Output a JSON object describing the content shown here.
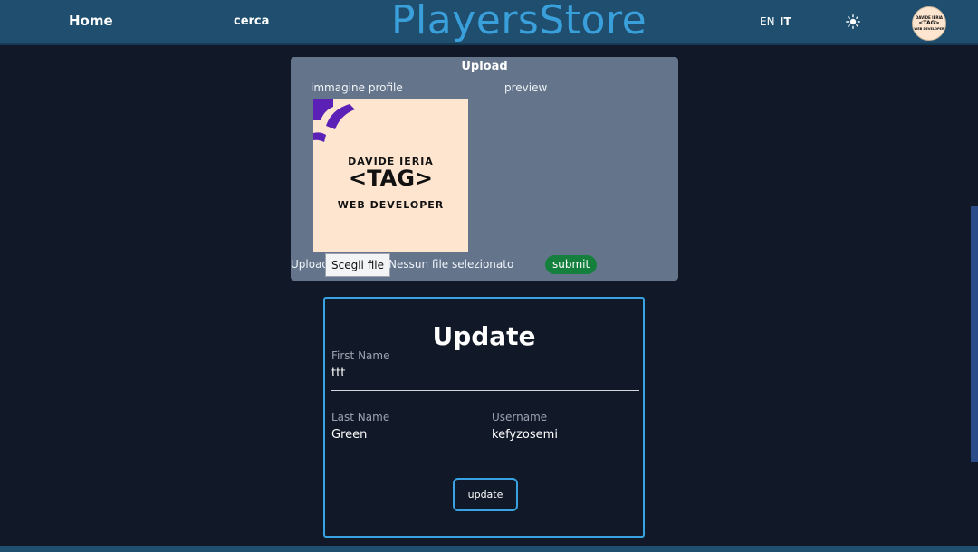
{
  "navbar": {
    "home": "Home",
    "search": "cerca",
    "brand": "PlayersStore",
    "lang_en": "EN",
    "lang_it": "IT",
    "theme_icon": "sun-icon",
    "avatar_name": "DAVIDE IERIA",
    "avatar_tag": "<TAG>",
    "avatar_role": "WEB DEVELOPER"
  },
  "upload": {
    "title": "Upload",
    "profile_label": "immagine profile",
    "preview_label": "preview",
    "image_name": "DAVIDE IERIA",
    "image_tag": "<TAG>",
    "image_role": "WEB DEVELOPER",
    "row_label": "Upload",
    "file_button": "Scegli file",
    "file_status": "Nessun file selezionato",
    "submit": "submit"
  },
  "update": {
    "title": "Update",
    "first_name_label": "First Name",
    "first_name_value": "ttt",
    "last_name_label": "Last Name",
    "last_name_value": "Green",
    "username_label": "Username",
    "username_value": "kefyzosemi",
    "button": "update"
  },
  "colors": {
    "background": "#111827",
    "navbar": "#1f4e6e",
    "brand": "#3aa0db",
    "upload_card": "#64748b",
    "submit": "#15803d",
    "accent_border": "#38a3e0"
  }
}
